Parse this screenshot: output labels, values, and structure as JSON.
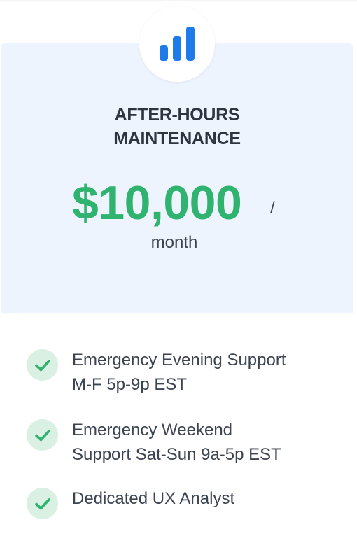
{
  "plan": {
    "icon": "bar-chart-icon",
    "title_line1": "AFTER-HOURS",
    "title_line2": "MAINTENANCE",
    "price": "$10,000",
    "price_separator": "/",
    "period": "month"
  },
  "features": [
    {
      "icon": "check-icon",
      "line1": "Emergency Evening Support",
      "line2": "M-F 5p-9p EST"
    },
    {
      "icon": "check-icon",
      "line1": "Emergency Weekend",
      "line2": "Support Sat-Sun 9a-5p EST"
    },
    {
      "icon": "check-icon",
      "line1": "Dedicated UX Analyst",
      "line2": ""
    }
  ],
  "colors": {
    "header_bg": "#eef4fe",
    "accent_blue": "#1e7be9",
    "price_green": "#2fb36f",
    "check_bg": "#d9f0e3",
    "text": "#3c4452"
  }
}
